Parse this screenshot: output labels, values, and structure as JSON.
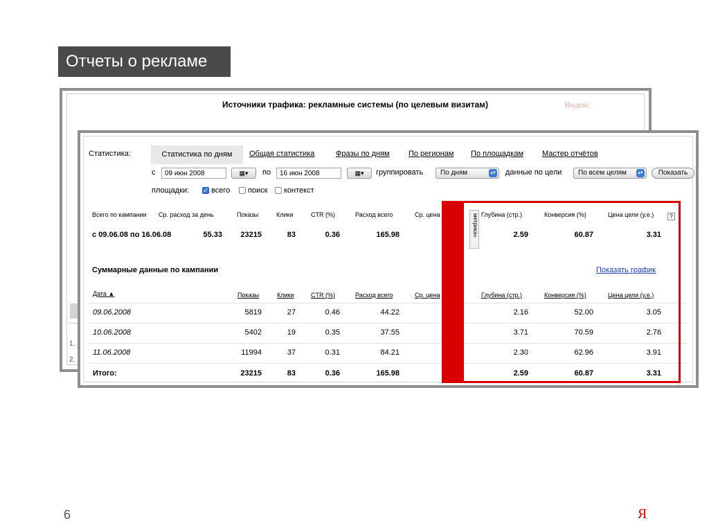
{
  "slide": {
    "title": "Отчеты о рекламе",
    "page_number": "6",
    "logo": "Я"
  },
  "back_screen": {
    "title": "Источники трафика: рекламные системы (по целевым визитам)",
    "logo": "Яндекс",
    "row_numbers": [
      "1.",
      "2."
    ]
  },
  "stats": {
    "label": "Статистика:",
    "tabs": [
      {
        "label": "Статистика по дням",
        "active": true
      },
      {
        "label": "Общая статистика",
        "active": false
      },
      {
        "label": "Фразы по дням",
        "active": false
      },
      {
        "label": "По регионам",
        "active": false
      },
      {
        "label": "По площадкам",
        "active": false
      },
      {
        "label": "Мастер отчётов",
        "active": false
      }
    ],
    "filters": {
      "from_label": "с",
      "from_date": "09 июн 2008",
      "to_label": "по",
      "to_date": "16 июн 2008",
      "group_label": "группировать",
      "group_value": "По дням",
      "goal_label": "данные по цели",
      "goal_value": "По всем целям",
      "show_button": "Показать",
      "calendar_button": "▦▾"
    },
    "platforms": {
      "label": "площадки:",
      "options": [
        {
          "label": "всего",
          "checked": true
        },
        {
          "label": "поиск",
          "checked": false
        },
        {
          "label": "контекст",
          "checked": false
        }
      ]
    },
    "summary": {
      "headers": [
        "Всего по кампании",
        "Ср. расход за день",
        "Показы",
        "Клики",
        "CTR (%)",
        "Расход всего",
        "Ср. цена",
        "Глубина (стр.)",
        "Конверсия (%)",
        "Цена цели (у.е.)"
      ],
      "period": "с 09.06.08 по 16.06.08",
      "avg_spend": "55.33",
      "impressions": "23215",
      "clicks": "83",
      "ctr": "0.36",
      "spend_total": "165.98",
      "depth": "2.59",
      "conversion": "60.87",
      "goal_price": "3.31",
      "metrika_label": "метрика»",
      "help": "?"
    },
    "campaign": {
      "title": "Суммарные данные по кампании",
      "chart_link": "Показать график",
      "headers": {
        "date": "Дата ▲",
        "impressions": "Показы",
        "clicks": "Клики",
        "ctr": "CTR (%)",
        "spend": "Расход всего",
        "avg_price": "Ср. цена",
        "depth": "Глубина (стр.)",
        "conversion": "Конверсия (%)",
        "goal_price": "Цена цели (у.е.)"
      },
      "rows": [
        {
          "date": "09.06.2008",
          "impressions": "5819",
          "clicks": "27",
          "ctr": "0.46",
          "spend": "44.22",
          "depth": "2.16",
          "conversion": "52.00",
          "goal_price": "3.05"
        },
        {
          "date": "10.06.2008",
          "impressions": "5402",
          "clicks": "19",
          "ctr": "0.35",
          "spend": "37.55",
          "depth": "3.71",
          "conversion": "70.59",
          "goal_price": "2.76"
        },
        {
          "date": "11.06.2008",
          "impressions": "11994",
          "clicks": "37",
          "ctr": "0.31",
          "spend": "84.21",
          "depth": "2.30",
          "conversion": "62.96",
          "goal_price": "3.91"
        }
      ],
      "total": {
        "label": "Итого:",
        "impressions": "23215",
        "clicks": "83",
        "ctr": "0.36",
        "spend": "165.98",
        "depth": "2.59",
        "conversion": "60.87",
        "goal_price": "3.31"
      }
    }
  },
  "highlight_color": "#d90000"
}
